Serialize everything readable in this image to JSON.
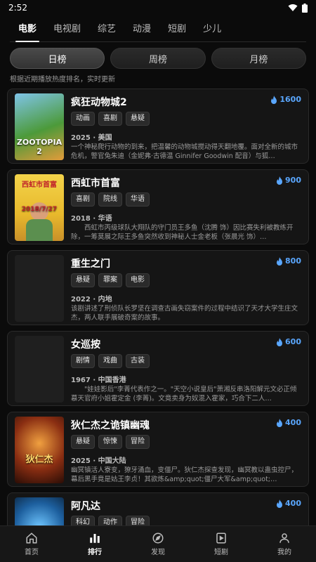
{
  "status": {
    "time": "2:52"
  },
  "categories": [
    {
      "label": "电影",
      "active": true
    },
    {
      "label": "电视剧"
    },
    {
      "label": "综艺"
    },
    {
      "label": "动漫"
    },
    {
      "label": "短剧"
    },
    {
      "label": "少儿"
    }
  ],
  "rank_tabs": [
    {
      "label": "日榜",
      "active": true
    },
    {
      "label": "周榜"
    },
    {
      "label": "月榜"
    }
  ],
  "hint": "根据近期播放热度排名，实时更新",
  "items": [
    {
      "title": "疯狂动物城2",
      "heat": "1600",
      "tags": [
        "动画",
        "喜剧",
        "悬疑"
      ],
      "meta": "2025 · 美国",
      "desc": "一个神秘爬行动物的到来，把温馨的动物城搅动得天翻地覆。面对全新的城市危机，警官兔朱迪（金妮弗·古德温 Ginnifer Goodwin 配音）与狐…",
      "poster_color": "#3e7a38",
      "poster_text": "ZOOTOPIA 2"
    },
    {
      "title": "西虹市首富",
      "heat": "900",
      "tags": [
        "喜剧",
        "院线",
        "华语"
      ],
      "meta": "2018 · 华语",
      "desc": "　　西虹市丙级球队大翔队的守门员王多鱼（沈腾 饰）因比赛失利被教练开除，一筹莫展之际王多鱼突然收到神秘人士金老板（张晨光 饰）…",
      "poster_color": "#e7c23a",
      "poster_top": "西虹市首富",
      "poster_text": "2018/7/27"
    },
    {
      "title": "重生之门",
      "heat": "800",
      "tags": [
        "悬疑",
        "罪案",
        "电影"
      ],
      "meta": "2022 · 内地",
      "desc": "该剧讲述了刑侦队长罗坚在调查古画失窃案件的过程中结识了天才大学生庄文杰，两人联手展破奇案的故事。",
      "poster_color": "#1f1f1f",
      "poster_text": ""
    },
    {
      "title": "女巡按",
      "heat": "600",
      "tags": [
        "剧情",
        "戏曲",
        "古装"
      ],
      "meta": "1967 · 中国香港",
      "desc": "　　\"娃娃影后\"李菁代表作之一。\"天空小说皇后\"萧湘反串洛阳解元文必正倾慕天官府小姐霍定金 (李菁)。文竟卖身为奴混入霍家，巧合下二人…",
      "poster_color": "#1f1f1f",
      "poster_text": ""
    },
    {
      "title": "狄仁杰之诡镇幽魂",
      "heat": "400",
      "tags": [
        "悬疑",
        "惊悚",
        "冒险"
      ],
      "meta": "2025 · 中国大陆",
      "desc": "幽冥镇活人寮变，獠牙涌血，变僵尸。狄仁杰探查发现，幽冥教以蛊虫控尸，幕后黑手竟是姑王李贞！其欲炼&amp;quot;僵尸大军&amp;quot;…",
      "poster_color": "#6b2a12",
      "poster_text": "狄仁杰"
    },
    {
      "title": "阿凡达",
      "heat": "400",
      "tags": [
        "科幻",
        "动作",
        "冒险"
      ],
      "meta": "",
      "desc": "",
      "poster_color": "#1d5f9e",
      "poster_text": ""
    }
  ],
  "nav": [
    {
      "label": "首页",
      "icon": "home-icon"
    },
    {
      "label": "排行",
      "icon": "chart-icon",
      "active": true
    },
    {
      "label": "发现",
      "icon": "compass-icon"
    },
    {
      "label": "短剧",
      "icon": "play-icon"
    },
    {
      "label": "我的",
      "icon": "user-icon"
    }
  ]
}
